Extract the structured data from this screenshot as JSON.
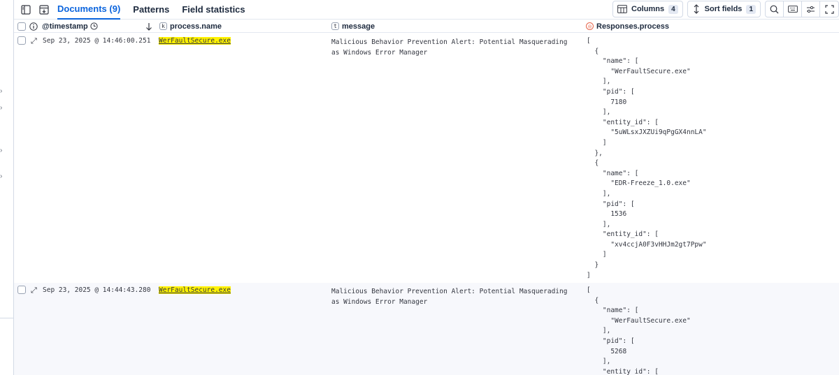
{
  "toolbar": {
    "tabs": [
      {
        "label": "Documents (9)",
        "active": true
      },
      {
        "label": "Patterns",
        "active": false
      },
      {
        "label": "Field statistics",
        "active": false
      }
    ],
    "columns_label": "Columns",
    "columns_count": "4",
    "sort_label": "Sort fields",
    "sort_count": "1",
    "icons": [
      "toggle-sidebar-icon",
      "save-icon",
      "magnifier-icon",
      "keyboard-icon",
      "controls-icon",
      "fullscreen-icon"
    ]
  },
  "columns": {
    "timestamp": "@timestamp",
    "process_name": "process.name",
    "process_name_type": "k",
    "message": "message",
    "message_type": "t",
    "responses": "Responses.process"
  },
  "rows": [
    {
      "timestamp": "Sep 23, 2025 @ 14:46:00.251",
      "process_name": "WerFaultSecure.exe",
      "message": "Malicious Behavior Prevention Alert: Potential Masquerading as Windows Error Manager",
      "responses": "[\n  {\n    \"name\": [\n      \"WerFaultSecure.exe\"\n    ],\n    \"pid\": [\n      7180\n    ],\n    \"entity_id\": [\n      \"5uWLsxJXZUi9qPgGX4nnLA\"\n    ]\n  },\n  {\n    \"name\": [\n      \"EDR-Freeze_1.0.exe\"\n    ],\n    \"pid\": [\n      1536\n    ],\n    \"entity_id\": [\n      \"xv4ccjA0F3vHHJm2gt7Ppw\"\n    ]\n  }\n]"
    },
    {
      "timestamp": "Sep 23, 2025 @ 14:44:43.280",
      "process_name": "WerFaultSecure.exe",
      "message": "Malicious Behavior Prevention Alert: Potential Masquerading as Windows Error Manager",
      "responses": "[\n  {\n    \"name\": [\n      \"WerFaultSecure.exe\"\n    ],\n    \"pid\": [\n      5268\n    ],\n    \"entity_id\": ["
    }
  ]
}
